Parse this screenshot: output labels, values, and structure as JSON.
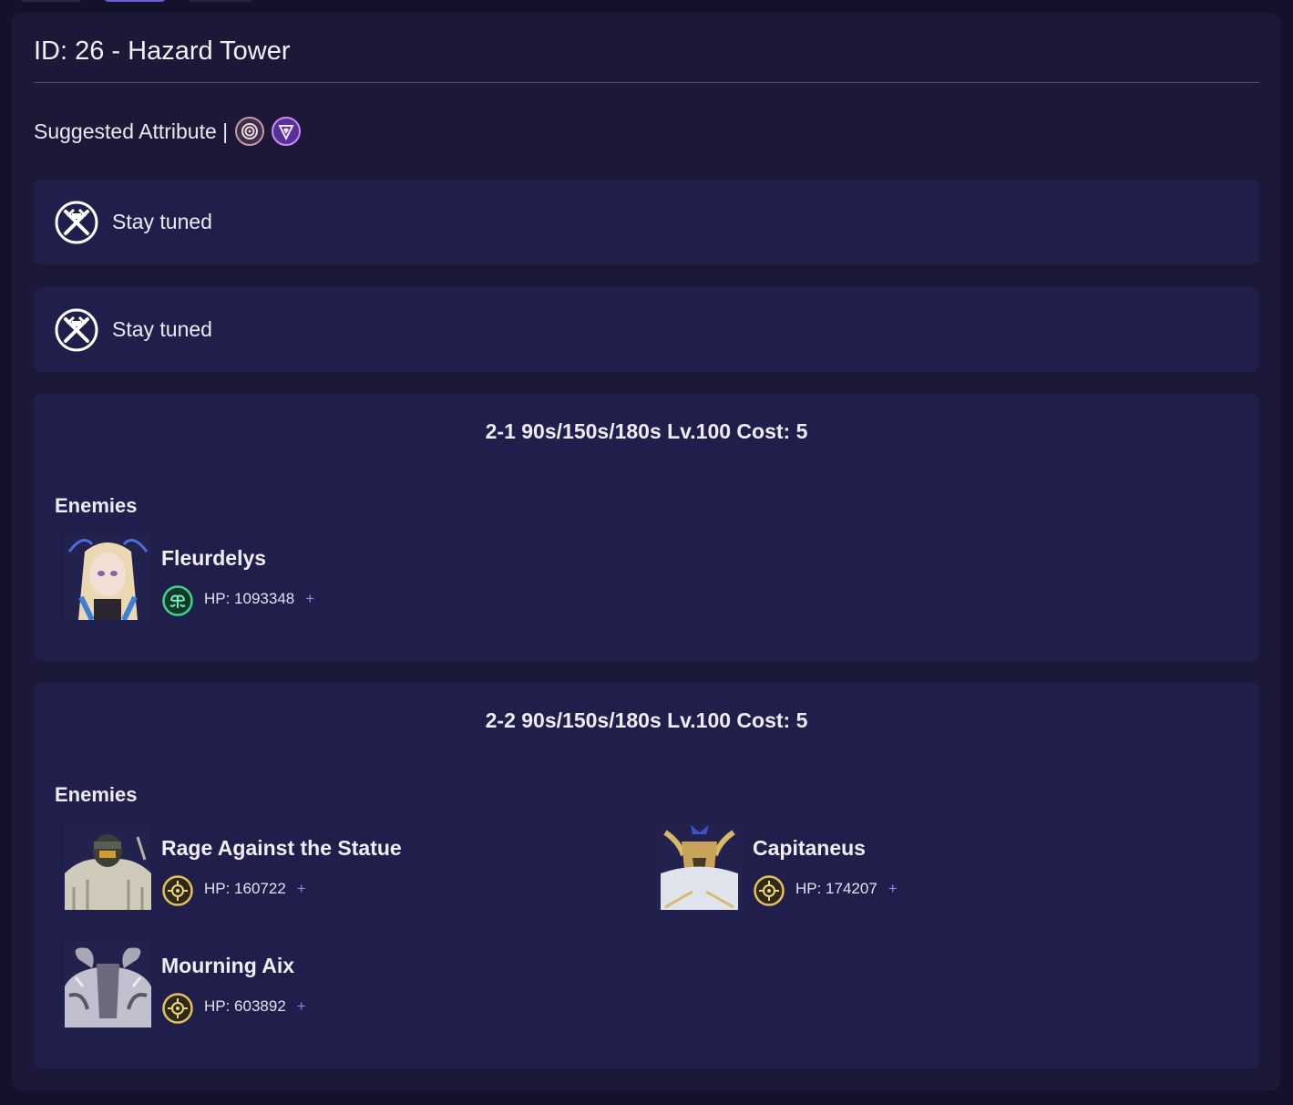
{
  "header": {
    "title": "ID: 26 - Hazard Tower"
  },
  "suggested": {
    "label": "Suggested Attribute |",
    "attributes": [
      "ring-attribute-icon",
      "scythe-attribute-icon"
    ]
  },
  "placeholders": [
    {
      "text": "Stay tuned",
      "icon": "crossed-swords-icon"
    },
    {
      "text": "Stay tuned",
      "icon": "crossed-swords-icon"
    }
  ],
  "stages": [
    {
      "title": "2-1 90s/150s/180s Lv.100 Cost: 5",
      "enemies_label": "Enemies",
      "enemies": [
        {
          "name": "Fleurdelys",
          "hp": "HP: 1093348",
          "element": "nature-icon",
          "expand": "+"
        }
      ]
    },
    {
      "title": "2-2 90s/150s/180s Lv.100 Cost: 5",
      "enemies_label": "Enemies",
      "enemies": [
        {
          "name": "Rage Against the Statue",
          "hp": "HP: 160722",
          "element": "light-icon",
          "expand": "+"
        },
        {
          "name": "Capitaneus",
          "hp": "HP: 174207",
          "element": "light-icon",
          "expand": "+"
        },
        {
          "name": "Mourning Aix",
          "hp": "HP: 603892",
          "element": "light-icon",
          "expand": "+"
        }
      ]
    }
  ],
  "colors": {
    "background": "#14122a",
    "card": "#1b1838",
    "panel": "#201e4a",
    "accent": "#8e86e8",
    "nature": "#3fd28c",
    "light": "#e4c15a"
  }
}
